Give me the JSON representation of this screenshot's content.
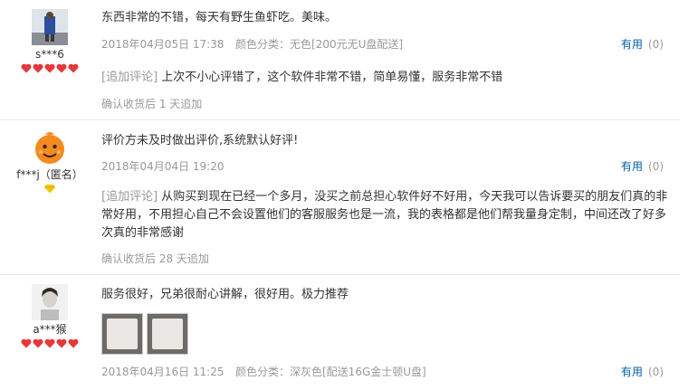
{
  "reviews": [
    {
      "username": "s***6",
      "text": "东西非常的不错，每天有野生鱼虾吃。美味。",
      "date": "2018年04月05日 17:38",
      "sku_label": "颜色分类：",
      "sku": "无色[200元无U盘配送]",
      "helpful_label": "有用",
      "helpful_count": "(0)",
      "addition_tag": "[追加评论]",
      "addition_text": "上次不小心评错了，这个软件非常不错，简单易懂，服务非常不错",
      "after": "确认收货后 1 天追加",
      "hearts": 5
    },
    {
      "username": "f***j（匿名）",
      "text": "评价方未及时做出评价,系统默认好评!",
      "date": "2018年04月04日 19:20",
      "helpful_label": "有用",
      "helpful_count": "(0)",
      "addition_tag": "[追加评论]",
      "addition_text": "从购买到现在已经一个多月，没买之前总担心软件好不好用，今天我可以告诉要买的朋友们真的非常好用，不用担心自己不会设置他们的客服服务也是一流，我的表格都是他们帮我量身定制，中间还改了好多次真的非常感谢",
      "after": "确认收货后 28 天追加",
      "badge": "diamond"
    },
    {
      "username": "a***猴",
      "text": "服务很好，兄弟很耐心讲解，很好用。极力推荐",
      "date": "2018年04月16日 11:25",
      "sku_label": "颜色分类：",
      "sku": "深灰色[配送16G金士顿U盘]",
      "helpful_label": "有用",
      "helpful_count": "(0)",
      "hearts": 5,
      "photos": 2
    }
  ],
  "colors": {
    "link": "#005ea7",
    "muted": "#999999",
    "heart": "#e4393c"
  }
}
